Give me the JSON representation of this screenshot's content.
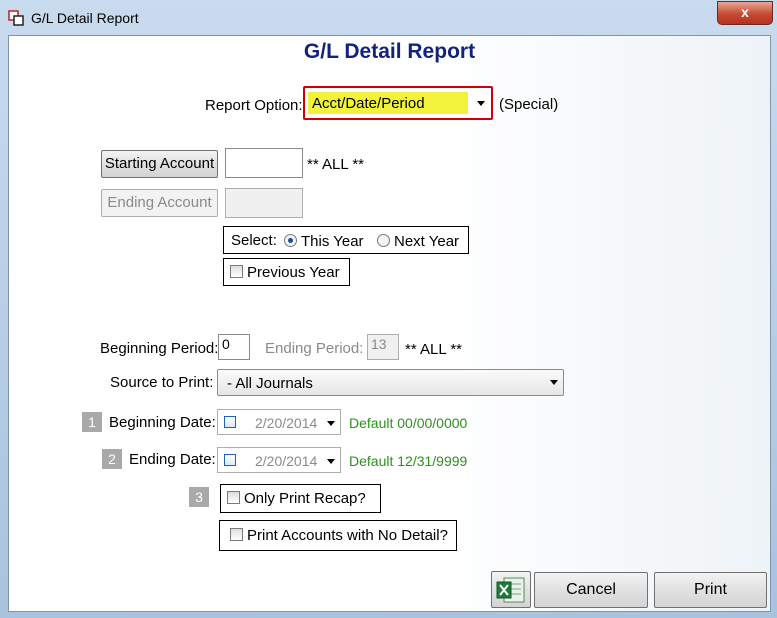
{
  "window": {
    "title": "G/L Detail Report",
    "close_glyph": "x"
  },
  "header": {
    "title": "G/L Detail Report"
  },
  "report_option": {
    "label": "Report Option:",
    "value": "Acct/Date/Period",
    "note": "(Special)"
  },
  "accounts": {
    "starting_button": "Starting Account",
    "starting_value": "",
    "all_note": "** ALL **",
    "ending_button": "Ending Account",
    "ending_value": ""
  },
  "year_select": {
    "label": "Select:",
    "this_year": "This Year",
    "next_year": "Next Year",
    "previous_year": "Previous Year",
    "selected": "This Year"
  },
  "period": {
    "beginning_label": "Beginning Period:",
    "beginning_value": "0",
    "ending_label": "Ending Period:",
    "ending_value": "13",
    "all_note": "** ALL **"
  },
  "source": {
    "label": "Source to Print:",
    "value": "- All Journals"
  },
  "beginning_date": {
    "badge": "1",
    "label": "Beginning Date:",
    "value": "2/20/2014",
    "default_note": "Default 00/00/0000"
  },
  "ending_date": {
    "badge": "2",
    "label": "Ending Date:",
    "value": "2/20/2014",
    "default_note": "Default 12/31/9999"
  },
  "options": {
    "badge": "3",
    "only_print_recap": "Only Print Recap?",
    "print_no_detail": "Print Accounts with No Detail?"
  },
  "footer": {
    "cancel": "Cancel",
    "print": "Print"
  },
  "colors": {
    "header": "#13237d",
    "highlight": "#f2f23c",
    "focus_border": "#d00000",
    "default_note": "#2f8f1f"
  }
}
